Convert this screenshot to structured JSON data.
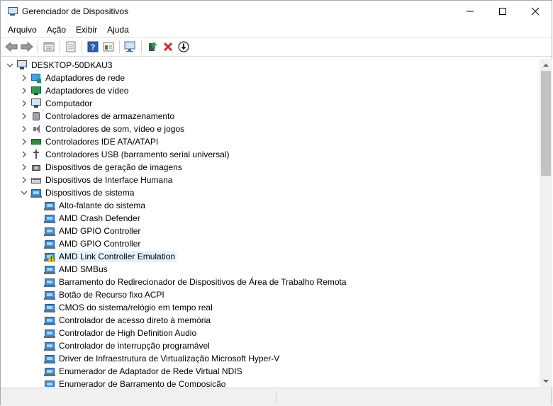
{
  "window": {
    "title": "Gerenciador de Dispositivos"
  },
  "menu": [
    "Arquivo",
    "Ação",
    "Exibir",
    "Ajuda"
  ],
  "toolbar_icons": [
    "back-arrow-icon",
    "forward-arrow-icon",
    "properties-icon",
    "resources-icon",
    "help-icon",
    "view-icon",
    "scan-hardware-icon",
    "update-driver-icon",
    "uninstall-device-icon",
    "disable-device-icon"
  ],
  "tree": {
    "root": "DESKTOP-50DKAU3",
    "categories": [
      {
        "label": "Adaptadores de rede",
        "icon": "network-adapter-icon"
      },
      {
        "label": "Adaptadores de vídeo",
        "icon": "display-adapter-icon"
      },
      {
        "label": "Computador",
        "icon": "computer-icon"
      },
      {
        "label": "Controladores de armazenamento",
        "icon": "storage-controller-icon"
      },
      {
        "label": "Controladores de som, vídeo e jogos",
        "icon": "sound-icon"
      },
      {
        "label": "Controladores IDE ATA/ATAPI",
        "icon": "ide-controller-icon"
      },
      {
        "label": "Controladores USB (barramento serial universal)",
        "icon": "usb-icon"
      },
      {
        "label": "Dispositivos de geração de imagens",
        "icon": "imaging-device-icon"
      },
      {
        "label": "Dispositivos de Interface Humana",
        "icon": "hid-icon"
      },
      {
        "label": "Dispositivos de sistema",
        "icon": "system-device-icon"
      }
    ],
    "system_devices": [
      "Alto-falante do sistema",
      "AMD Crash Defender",
      "AMD GPIO Controller",
      "AMD GPIO Controller",
      "AMD Link Controller Emulation",
      "AMD SMBus",
      "Barramento do Redirecionador de Dispositivos de Área de Trabalho Remota",
      "Botão de Recurso fixo ACPI",
      "CMOS do sistema/relógio em tempo real",
      "Controlador de acesso direto à memória",
      "Controlador de High Definition Audio",
      "Controlador de interrupção programável",
      "Driver de Infraestrutura de Virtualização Microsoft Hyper-V",
      "Enumerador de Adaptador de Rede Virtual NDIS",
      "Enumerador de Barramento de Composição"
    ]
  },
  "colors": {
    "selection": "#e5f3ff",
    "warning": "#f2c200",
    "device_blue": "#3a8ed8",
    "close_red": "#d9252b",
    "scan_green": "#2e8b57"
  }
}
